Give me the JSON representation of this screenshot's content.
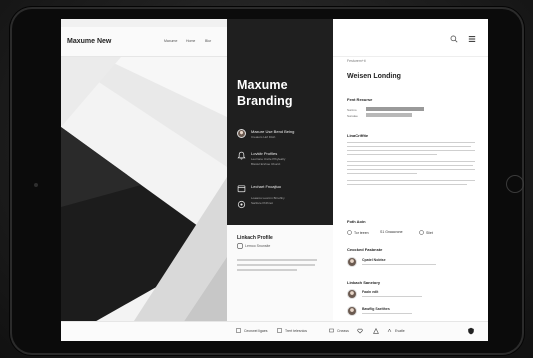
{
  "statusbar": {
    "left": "iPad ✈ ᯤ",
    "right": "✱ ▮"
  },
  "app": {
    "title": "Maxume New",
    "nav": [
      "Maxume",
      "Home",
      "Blur"
    ]
  },
  "hero": {
    "line1": "Maxume",
    "line2": "Branding"
  },
  "menu": [
    {
      "title": "Maxure Use Bend Being",
      "sub1": "Creators Hof Fitsh",
      "sub2": ""
    },
    {
      "title": "Lovkitr Profiles",
      "sub1": "Leorrane Uncle Pthyleafiy",
      "sub2": "Bisstul Ershoe Ubucct"
    },
    {
      "title": "Lechart Fnoajtuo",
      "sub1": "Loaaros Leormn Brnoflny",
      "sub2": "Sartfere Prdhnot"
    }
  ],
  "middle_bottom": {
    "title": "Linkach Profile",
    "sub": "Lemoo Snunsite"
  },
  "right": {
    "crumb": "Festurem+ti",
    "title": "Weisen Londing",
    "section1": "Fent Rexurse",
    "section1_rows": [
      "Suntno",
      "Sunslee"
    ],
    "section2": "LinaCriffite",
    "section3": "Foth Aoin",
    "chips": [
      "Tor teeen",
      "S1 Gnaacrone",
      "Sliet"
    ],
    "section4": "Ceocked Fasbnste",
    "section5": "Linkach Saneiory",
    "people": [
      "Cpatel Nobtse",
      "Faaln edlt",
      "Bawflig Saelthes"
    ]
  },
  "toolbar": {
    "buttons": [
      "Cecnwei ligaes",
      "Trert telesnios",
      "Cneass",
      "Evatle"
    ]
  },
  "colors": {
    "dark_panel": "#1f1f1f",
    "accent": "#222222",
    "muted": "#9a9a9a"
  }
}
